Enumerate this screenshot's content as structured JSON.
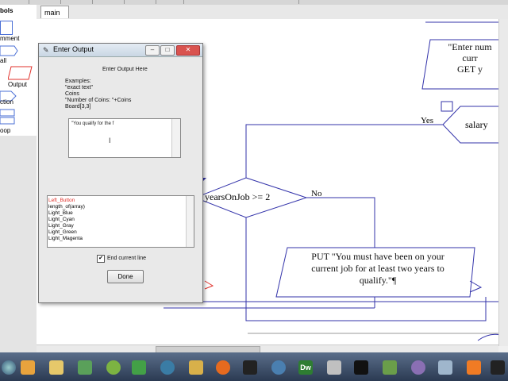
{
  "symbols_panel": {
    "items": [
      {
        "label": "bols"
      },
      {
        "label": "mment"
      },
      {
        "label": "all"
      },
      {
        "label": "Output"
      },
      {
        "label": "ction"
      },
      {
        "label": "oop"
      }
    ]
  },
  "tabs": [
    {
      "label": "main"
    }
  ],
  "flowchart": {
    "input_text_lines": [
      "\"Enter num",
      "curr",
      "GET y"
    ],
    "yes_label": "Yes",
    "salary_label": "salary",
    "decision_text": "yearsOnJob >= 2",
    "no_label": "No",
    "output_lines": [
      "PUT \"You must have been on your",
      "current job for at least two years to",
      "qualify.\"¶"
    ]
  },
  "dialog": {
    "title": "Enter Output",
    "heading": "Enter Output Here",
    "examples_lines": [
      "Examples:",
      "\"exact text\"",
      "Coins",
      "\"Number of Coins: \"+Coins",
      "Board[3,3]"
    ],
    "text_value": "\"You qualify for the f",
    "list_items": [
      "Left_Button",
      "length_of(array)",
      "Light_Blue",
      "Light_Cyan",
      "Light_Gray",
      "Light_Green",
      "Light_Magenta"
    ],
    "end_line_label": "End current line",
    "end_line_checked": "✔",
    "done_label": "Done"
  },
  "taskbar": {
    "icons": [
      "start-orb-icon",
      "media-player-icon",
      "folder-icon",
      "chat-icon",
      "firefox-alt-icon",
      "frog-icon",
      "network-icon",
      "paint-icon",
      "firefox-icon",
      "cursor-tool-icon",
      "globe-icon",
      "dreamweaver-icon",
      "java-icon",
      "terminal-icon",
      "spreadsheet-icon",
      "circle-app-icon",
      "cube-icon",
      "xampp-icon",
      "dark-app-icon"
    ]
  },
  "colors": {
    "flowline": "#3333aa",
    "list_highlight": "#e0312b",
    "dreamweaver": "#2e7d32"
  }
}
